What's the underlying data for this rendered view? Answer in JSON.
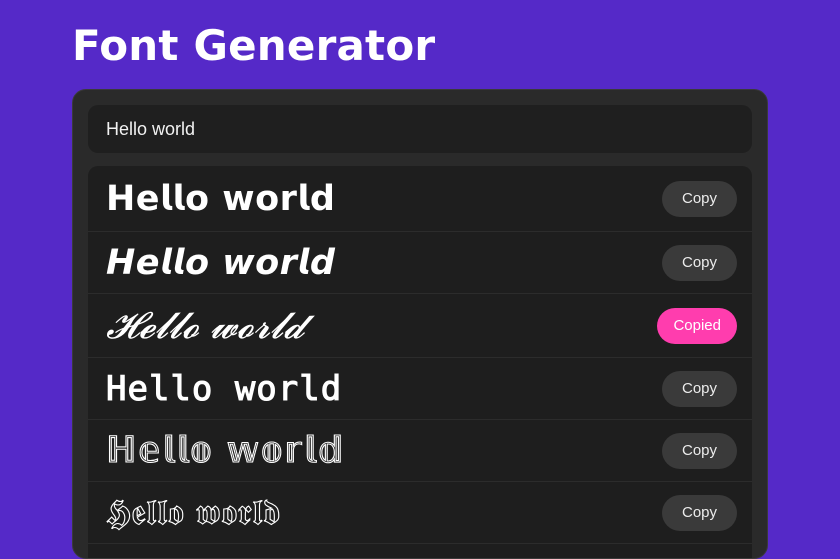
{
  "header": {
    "title": "Font Generator"
  },
  "input": {
    "value": "Hello world"
  },
  "rows": [
    {
      "text": "𝗛𝗲𝗹𝗹𝗼 𝘄𝗼𝗿𝗹𝗱",
      "button": "Copy",
      "state": "default"
    },
    {
      "text": "𝙃𝙚𝙡𝙡𝙤 𝙬𝙤𝙧𝙡𝙙",
      "button": "Copy",
      "state": "default"
    },
    {
      "text": "𝓗𝓮𝓵𝓵𝓸 𝔀𝓸𝓻𝓵𝓭",
      "button": "Copied",
      "state": "copied"
    },
    {
      "text": "𝙷𝚎𝚕𝚕𝚘 𝚠𝚘𝚛𝚕𝚍",
      "button": "Copy",
      "state": "default"
    },
    {
      "text": "ℍ𝕖𝕝𝕝𝕠 𝕨𝕠𝕣𝕝𝕕",
      "button": "Copy",
      "state": "default"
    },
    {
      "text": "𝕳𝖊𝖑𝖑𝖔 𝖜𝖔𝖗𝖑𝖉",
      "button": "Copy",
      "state": "default"
    }
  ],
  "colors": {
    "background": "#5529c8",
    "panel": "#2a2a2a",
    "copied_accent": "#ff3dae"
  }
}
